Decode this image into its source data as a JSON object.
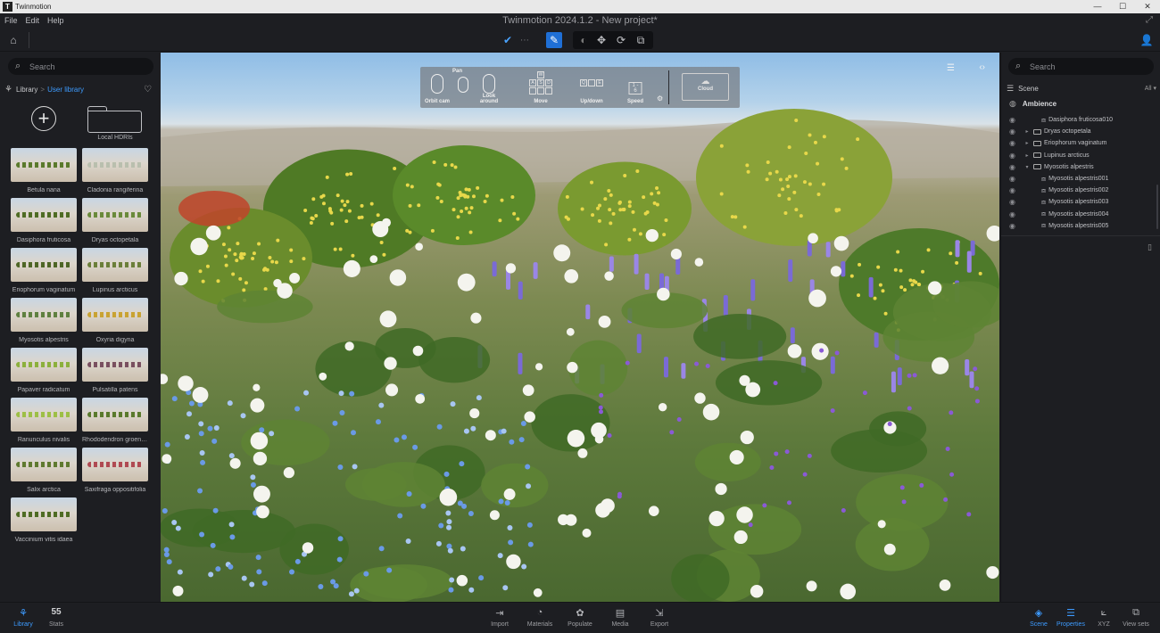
{
  "titlebar": {
    "app_icon": "T",
    "app_name": "Twinmotion",
    "minimize": "—",
    "maximize": "☐",
    "close": "✕"
  },
  "menubar": {
    "items": [
      "File",
      "Edit",
      "Help"
    ],
    "document_title": "Twinmotion 2024.1.2 - New project*",
    "expand_icon": "⤢"
  },
  "toolbar": {
    "home_icon": "⌂",
    "check_icon": "✔",
    "grid_icon": "⋯",
    "pick_icon": "✎",
    "nav_icons": [
      "◐",
      "✥",
      "⟳",
      "⧉"
    ],
    "user_icon": "👤"
  },
  "library": {
    "search_placeholder": "Search",
    "search_icon": "⌕",
    "breadcrumb_root": "Library",
    "breadcrumb_sep": ">",
    "breadcrumb_current": "User library",
    "add_label": "+",
    "hdri_label": "Local HDRIs",
    "assets": [
      {
        "name": "Betula nana",
        "color": "#5a7a2c"
      },
      {
        "name": "Cladonia rangiferina",
        "color": "#b9bfae"
      },
      {
        "name": "Dasiphora fruticosa",
        "color": "#4f6c24"
      },
      {
        "name": "Dryas octopetala",
        "color": "#6a8a3a"
      },
      {
        "name": "Eriophorum vaginatum",
        "color": "#4e6626"
      },
      {
        "name": "Lupinus arcticus",
        "color": "#6b7f3a"
      },
      {
        "name": "Myosotis alpestris",
        "color": "#5f8040"
      },
      {
        "name": "Oxyria digyna",
        "color": "#c9a332"
      },
      {
        "name": "Papaver radicatum",
        "color": "#8cb03c"
      },
      {
        "name": "Pulsatilla patens",
        "color": "#7a5060"
      },
      {
        "name": "Ranunculus nivalis",
        "color": "#9dbf46"
      },
      {
        "name": "Rhododendron groenla...",
        "color": "#5a7a2c"
      },
      {
        "name": "Salix arctica",
        "color": "#5f7a30"
      },
      {
        "name": "Saxifraga oppositifolia",
        "color": "#b04a52"
      },
      {
        "name": "Vaccinium vitis idaea",
        "color": "#4f6c24"
      }
    ]
  },
  "navhelp": {
    "pan": "Pan",
    "items": [
      {
        "label": "Orbit cam"
      },
      {
        "label": "Look around"
      },
      {
        "label": "Move",
        "keys": [
          "",
          "W",
          "",
          "A",
          "S",
          "D",
          "",
          "",
          ""
        ]
      },
      {
        "label": "Up/down",
        "keys": [
          "Q",
          "",
          "E"
        ]
      },
      {
        "label": "Speed",
        "text": "1 - 6"
      }
    ],
    "cloud_label": "Cloud",
    "cloud_icon": "☁",
    "gear_icon": "⚙"
  },
  "viewport": {
    "list_icon": "☰",
    "code_icon": "‹›"
  },
  "scene": {
    "search_placeholder": "Search",
    "search_icon": "⌕",
    "title": "Scene",
    "filter": "All ▾",
    "scene_icon": "☰",
    "ambience": "Ambience",
    "ambience_icon": "◍",
    "tree": [
      {
        "label": "Dasiphora fruticosa010",
        "type": "object",
        "level": 1
      },
      {
        "label": "Dryas octopetala",
        "type": "folder",
        "level": 0,
        "caret": "▸"
      },
      {
        "label": "Eriophorum vaginatum",
        "type": "folder",
        "level": 0,
        "caret": "▸"
      },
      {
        "label": "Lupinus arcticus",
        "type": "folder",
        "level": 0,
        "caret": "▸"
      },
      {
        "label": "Myosotis alpestris",
        "type": "folder",
        "level": 0,
        "caret": "▾"
      },
      {
        "label": "Myosotis alpestris001",
        "type": "object",
        "level": 1
      },
      {
        "label": "Myosotis alpestris002",
        "type": "object",
        "level": 1
      },
      {
        "label": "Myosotis alpestris003",
        "type": "object",
        "level": 1
      },
      {
        "label": "Myosotis alpestris004",
        "type": "object",
        "level": 1
      },
      {
        "label": "Myosotis alpestris005",
        "type": "object",
        "level": 1
      }
    ],
    "panel_icon": "▯"
  },
  "bottombar": {
    "left": [
      {
        "label": "Library",
        "icon": "⚘",
        "active": true
      },
      {
        "label": "Stats",
        "icon": "55",
        "active": false
      }
    ],
    "center": [
      {
        "label": "Import",
        "icon": "⇥"
      },
      {
        "label": "Materials",
        "icon": "◔"
      },
      {
        "label": "Populate",
        "icon": "✿"
      },
      {
        "label": "Media",
        "icon": "▤"
      },
      {
        "label": "Export",
        "icon": "⇲"
      }
    ],
    "right": [
      {
        "label": "Scene",
        "icon": "◈",
        "active": true
      },
      {
        "label": "Properties",
        "icon": "☰",
        "active": true
      },
      {
        "label": "XYZ",
        "icon": "⟀",
        "active": false
      },
      {
        "label": "View sets",
        "icon": "⧉",
        "active": false
      }
    ]
  }
}
